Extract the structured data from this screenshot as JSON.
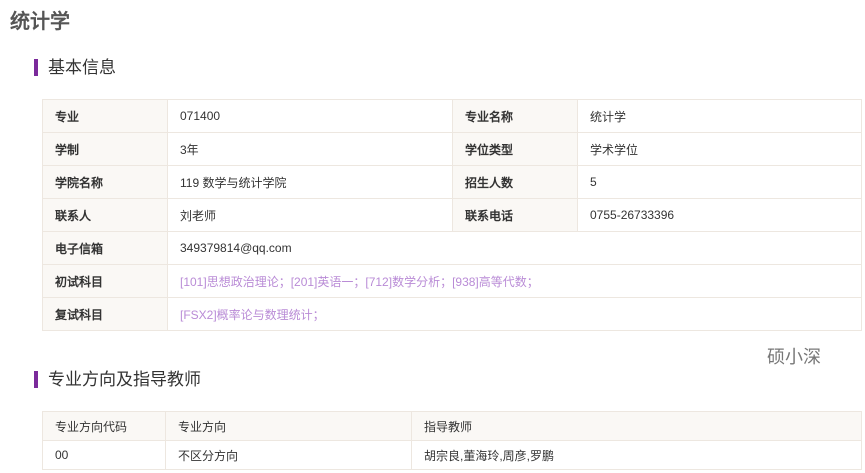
{
  "title": "统计学",
  "section1": "基本信息",
  "basic": {
    "major_label": "专业",
    "major": "071400",
    "major_name_label": "专业名称",
    "major_name": "统计学",
    "duration_label": "学制",
    "duration": "3年",
    "degree_label": "学位类型",
    "degree": "学术学位",
    "college_label": "学院名称",
    "college": "119 数学与统计学院",
    "enroll_label": "招生人数",
    "enroll": "5",
    "contact_label": "联系人",
    "contact": "刘老师",
    "phone_label": "联系电话",
    "phone": "0755-26733396",
    "email_label": "电子信箱",
    "email": "349379814@qq.com",
    "exam_label": "初试科目",
    "exam": "[101]思想政治理论；[201]英语一；[712]数学分析；[938]高等代数；",
    "retest_label": "复试科目",
    "retest": "[FSX2]概率论与数理统计；"
  },
  "watermark": "硕小深",
  "section2": "专业方向及指导教师",
  "directions": {
    "headers": [
      "专业方向代码",
      "专业方向",
      "指导教师"
    ],
    "rows": [
      [
        "00",
        "不区分方向",
        "胡宗良,董海玲,周彦,罗鹏"
      ]
    ]
  }
}
